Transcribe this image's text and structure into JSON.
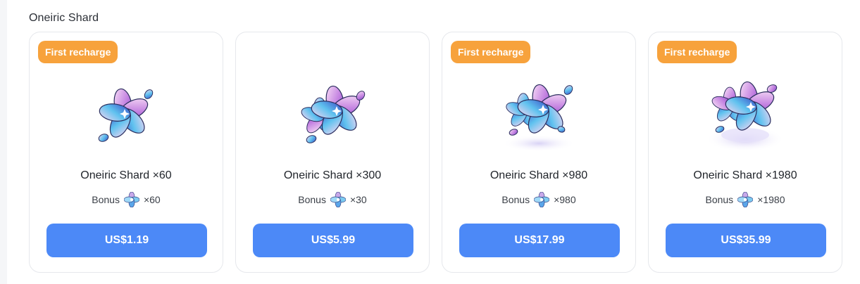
{
  "section": {
    "title": "Oneiric Shard"
  },
  "colors": {
    "badge": "#f7a23c",
    "button": "#4c89f7",
    "border": "#e6e8ec"
  },
  "cards": [
    {
      "badge": "First recharge",
      "title": "Oneiric Shard ×60",
      "bonus_label": "Bonus",
      "bonus_amount": "×60",
      "price": "US$1.19",
      "icon": "oneiric-shard-small-icon"
    },
    {
      "badge": "",
      "title": "Oneiric Shard ×300",
      "bonus_label": "Bonus",
      "bonus_amount": "×30",
      "price": "US$5.99",
      "icon": "oneiric-shard-cluster-icon"
    },
    {
      "badge": "First recharge",
      "title": "Oneiric Shard ×980",
      "bonus_label": "Bonus",
      "bonus_amount": "×980",
      "price": "US$17.99",
      "icon": "oneiric-shard-pile-icon"
    },
    {
      "badge": "First recharge",
      "title": "Oneiric Shard ×1980",
      "bonus_label": "Bonus",
      "bonus_amount": "×1980",
      "price": "US$35.99",
      "icon": "oneiric-shard-heap-icon"
    }
  ]
}
